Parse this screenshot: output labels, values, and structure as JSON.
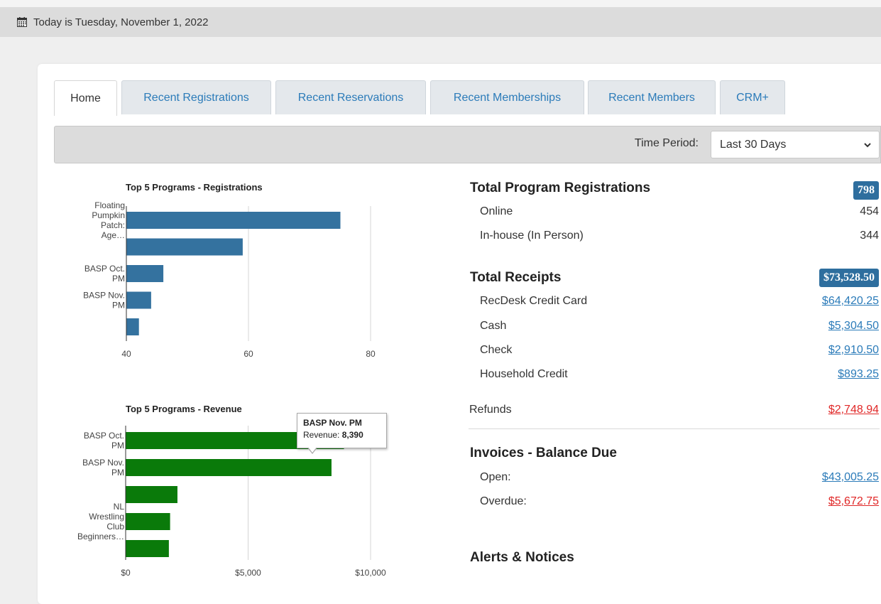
{
  "date_bar": {
    "icon": "calendar-icon",
    "text": "Today is Tuesday, November 1, 2022"
  },
  "tabs": [
    {
      "label": "Home",
      "active": true
    },
    {
      "label": "Recent Registrations",
      "active": false
    },
    {
      "label": "Recent Reservations",
      "active": false
    },
    {
      "label": "Recent Memberships",
      "active": false
    },
    {
      "label": "Recent Members",
      "active": false
    },
    {
      "label": "CRM+",
      "active": false
    }
  ],
  "filter": {
    "label": "Time Period:",
    "value": "Last 30 Days"
  },
  "colors": {
    "accent": "#2b7bb9",
    "badge": "#2e6e9e",
    "negative": "#e02727",
    "reg_bar": "#34729f",
    "rev_bar": "#0a7a0a"
  },
  "chart_data": [
    {
      "type": "bar",
      "orientation": "horizontal",
      "title": "Top 5 Programs - Registrations",
      "categories": [
        "Floating Pumpkin Patch: Age…",
        "",
        "BASP Oct. PM",
        "BASP Nov. PM",
        ""
      ],
      "values": [
        75,
        59,
        46,
        44,
        42
      ],
      "xlim": [
        40,
        80
      ],
      "xticks": [
        "40",
        "60",
        "80"
      ],
      "grid": true
    },
    {
      "type": "bar",
      "orientation": "horizontal",
      "title": "Top 5 Programs - Revenue",
      "categories": [
        "BASP Oct. PM",
        "BASP Nov. PM",
        "",
        "NL Wrestling Club Beginners…",
        ""
      ],
      "values": [
        8900,
        8390,
        2100,
        1800,
        1750
      ],
      "xlim": [
        0,
        10000
      ],
      "xticks": [
        "$0",
        "$5,000",
        "$10,000"
      ],
      "grid": true,
      "tooltip": {
        "title": "BASP Nov. PM",
        "label": "Revenue:",
        "value": "8,390"
      }
    }
  ],
  "registrations": {
    "title": "Total Program Registrations",
    "total": "798",
    "rows": [
      {
        "label": "Online",
        "value": "454"
      },
      {
        "label": "In-house (In Person)",
        "value": "344"
      }
    ]
  },
  "receipts": {
    "title": "Total Receipts",
    "total": "$73,528.50",
    "rows": [
      {
        "label": "RecDesk Credit Card",
        "value": "$64,420.25"
      },
      {
        "label": "Cash",
        "value": "$5,304.50"
      },
      {
        "label": "Check",
        "value": "$2,910.50"
      },
      {
        "label": "Household Credit",
        "value": "$893.25"
      }
    ],
    "refunds": {
      "label": "Refunds",
      "value": "$2,748.94"
    }
  },
  "invoices": {
    "title": "Invoices - Balance Due",
    "rows": [
      {
        "label": "Open:",
        "value": "$43,005.25"
      },
      {
        "label": "Overdue:",
        "value": "$5,672.75"
      }
    ]
  },
  "alerts": {
    "title": "Alerts & Notices"
  }
}
